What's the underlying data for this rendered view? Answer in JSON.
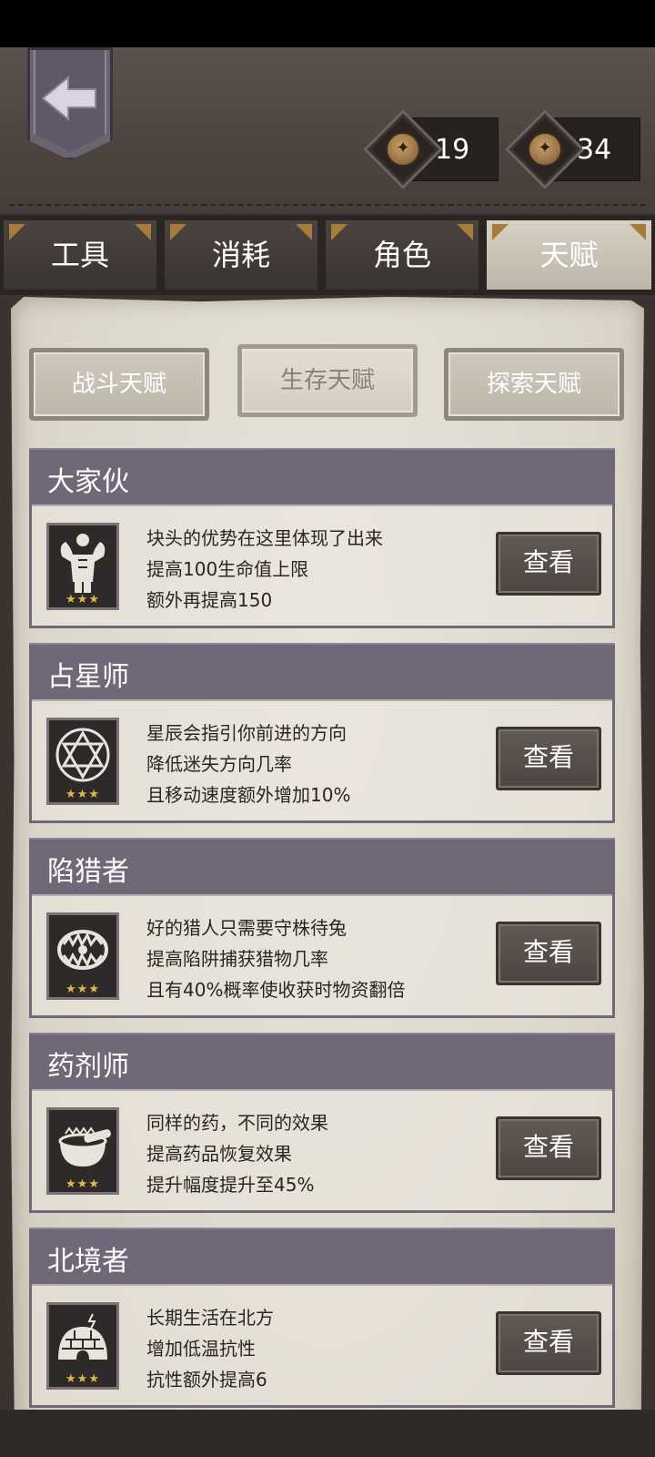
{
  "header": {
    "currencies": [
      {
        "value": "19",
        "icon": "compass-coin-icon"
      },
      {
        "value": "34",
        "icon": "compass-coin-icon"
      }
    ]
  },
  "main_tabs": [
    {
      "label": "工具",
      "active": false
    },
    {
      "label": "消耗",
      "active": false
    },
    {
      "label": "角色",
      "active": false
    },
    {
      "label": "天赋",
      "active": true
    }
  ],
  "sub_tabs": [
    {
      "label": "战斗天赋",
      "active": false
    },
    {
      "label": "生存天赋",
      "active": true
    },
    {
      "label": "探索天赋",
      "active": false
    }
  ],
  "talents": [
    {
      "title": "大家伙",
      "icon": "muscle-man-icon",
      "stars": 3,
      "lines": [
        "块头的优势在这里体现了出来",
        "提高100生命值上限",
        "额外再提高150"
      ],
      "button": "查看"
    },
    {
      "title": "占星师",
      "icon": "hexagram-icon",
      "stars": 3,
      "lines": [
        "星辰会指引你前进的方向",
        "降低迷失方向几率",
        "且移动速度额外增加10%"
      ],
      "button": "查看"
    },
    {
      "title": "陷猎者",
      "icon": "bear-trap-icon",
      "stars": 3,
      "lines": [
        "好的猎人只需要守株待兔",
        "提高陷阱捕获猎物几率",
        "且有40%概率使收获时物资翻倍"
      ],
      "button": "查看"
    },
    {
      "title": "药剂师",
      "icon": "mortar-pestle-icon",
      "stars": 3,
      "lines": [
        "同样的药，不同的效果",
        "提高药品恢复效果",
        "提升幅度提升至45%"
      ],
      "button": "查看"
    },
    {
      "title": "北境者",
      "icon": "igloo-icon",
      "stars": 3,
      "lines": [
        "长期生活在北方",
        "增加低温抗性",
        "抗性额外提高6"
      ],
      "button": "查看"
    }
  ],
  "colors": {
    "title_bar": "#6f6878",
    "parchment": "#ddd8cc",
    "star": "#e3b84a",
    "tab_corner": "#a87b3a"
  }
}
